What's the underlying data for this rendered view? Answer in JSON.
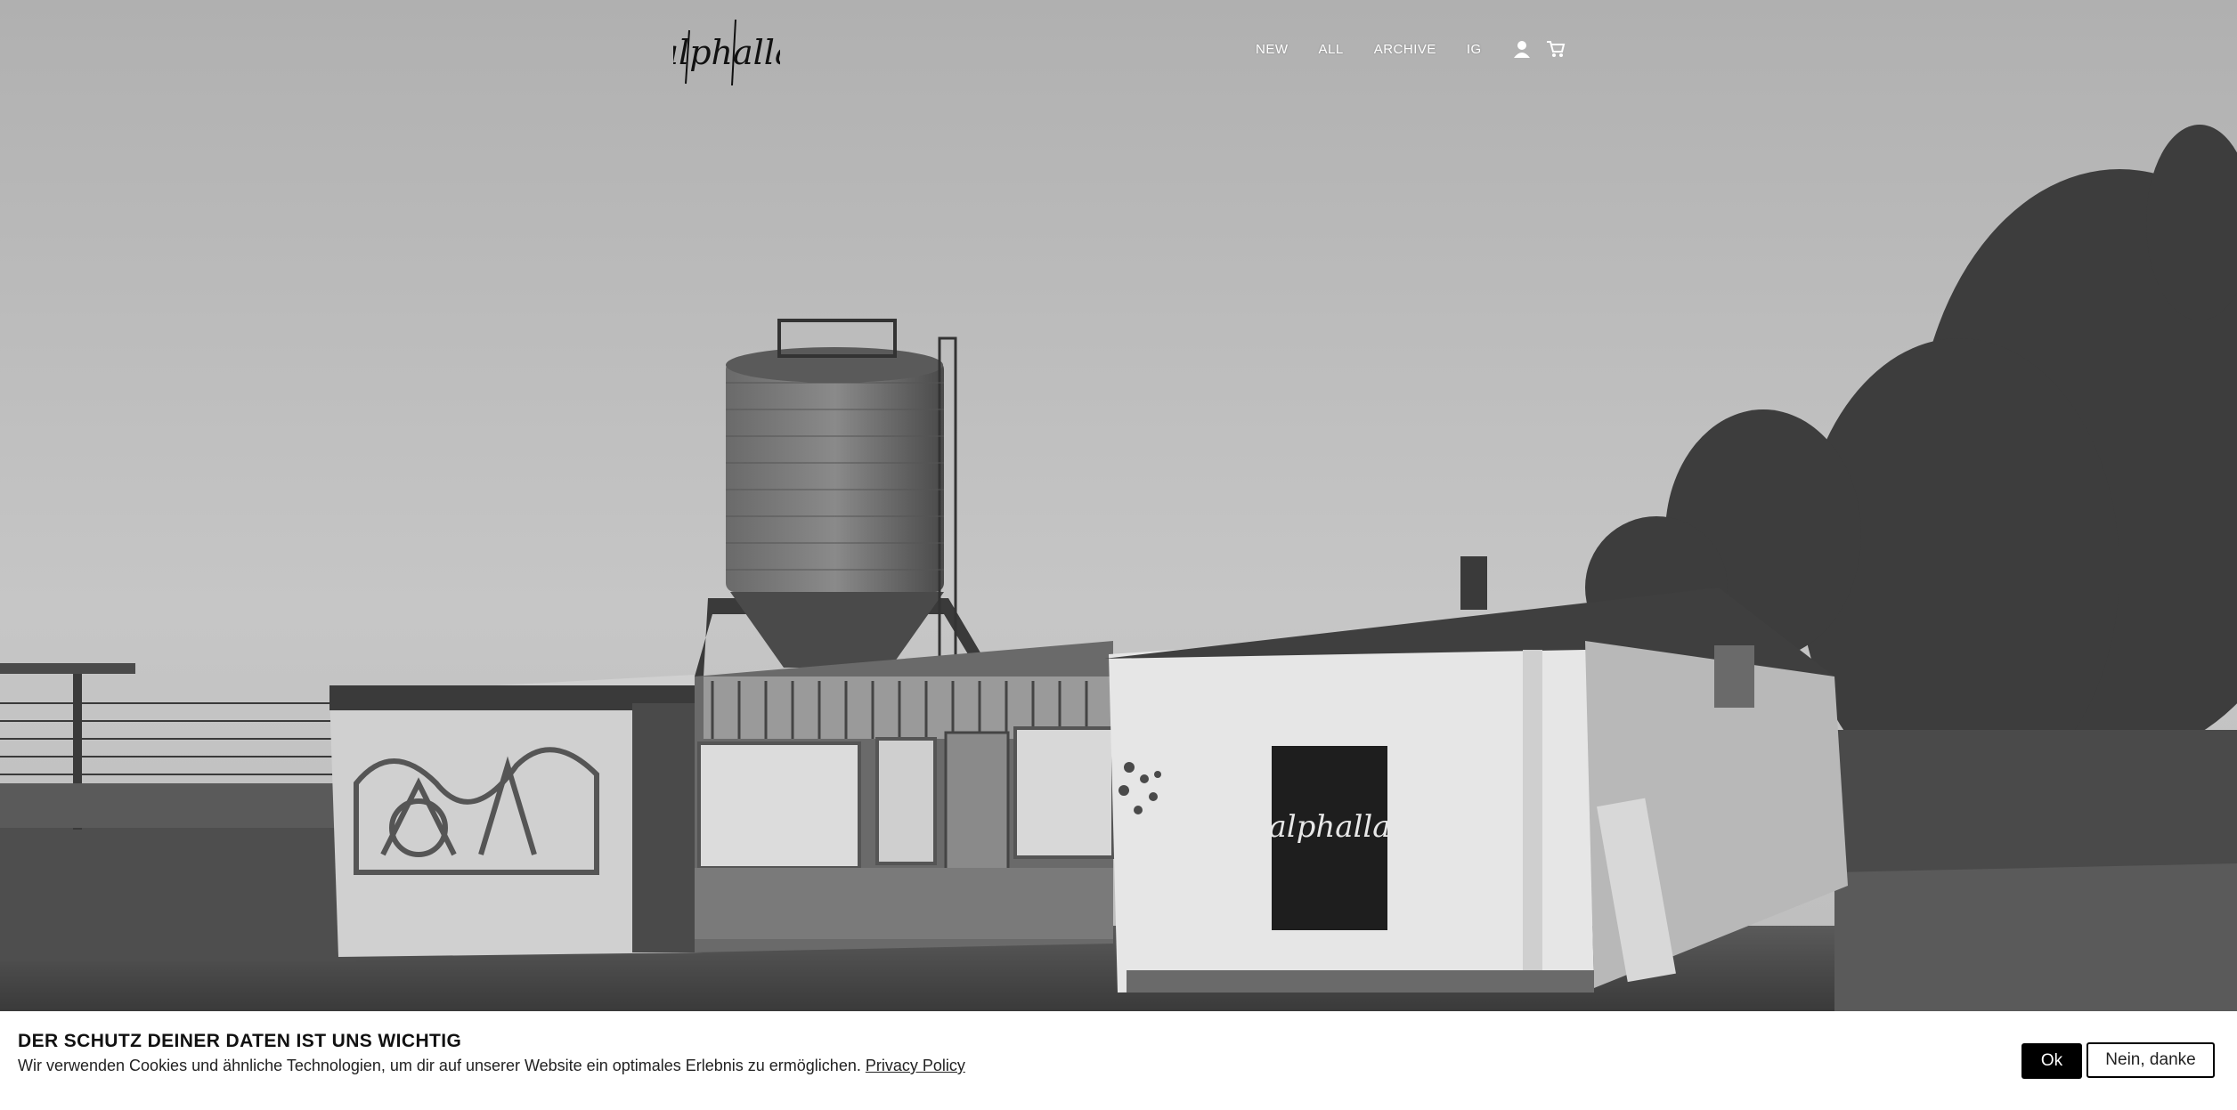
{
  "header": {
    "logo_text": "alphalla",
    "nav": [
      {
        "label": "NEW"
      },
      {
        "label": "ALL"
      },
      {
        "label": "ARCHIVE"
      },
      {
        "label": "IG"
      }
    ],
    "icons": [
      "account-icon",
      "cart-icon"
    ]
  },
  "hero": {
    "poster_text": "alphalla"
  },
  "cookie_banner": {
    "title": "DER SCHUTZ DEINER DATEN IST UNS WICHTIG",
    "text": "Wir verwenden Cookies und ähnliche Technologien, um dir auf unserer Website ein optimales Erlebnis zu ermöglichen.",
    "link": "Privacy Policy",
    "ok_label": "Ok",
    "decline_label": "Nein, danke"
  },
  "colors": {
    "banner_bg": "#ffffff",
    "button_dark": "#000000",
    "nav_text": "#ffffff"
  }
}
